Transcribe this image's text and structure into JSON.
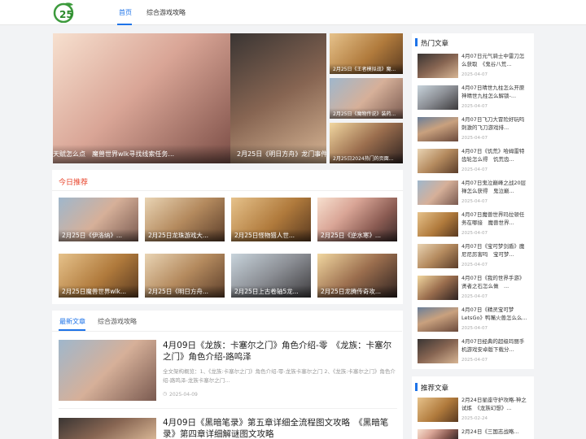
{
  "header": {
    "logo_text": "25",
    "nav": [
      {
        "label": "首页"
      },
      {
        "label": "综合游戏攻略"
      }
    ]
  },
  "carousel": {
    "main_caption_left": "天赋怎么点　魔兽世界wlk寻找线索任务...",
    "main_caption_right": "2月25日《明日方舟》龙门事件...",
    "side": [
      {
        "caption": "2月25日《王者模拟战》魔..."
      },
      {
        "caption": "2月25日《魔物传说》装药..."
      },
      {
        "caption": "2月25日2024热门的页面..."
      }
    ]
  },
  "today": {
    "title": "今日推荐",
    "items": [
      {
        "caption": "2月25日《伊洛纳》..."
      },
      {
        "caption": "2月25日龙珠游戏大..."
      },
      {
        "caption": "2月25日怪物猎人世..."
      },
      {
        "caption": "2月25日《逆水寒》..."
      },
      {
        "caption": "2月25日魔兽世界wlk..."
      },
      {
        "caption": "2月25日《明日方舟..."
      },
      {
        "caption": "2月25日上古卷轴5龙..."
      },
      {
        "caption": "2月25日龙腾传奇攻..."
      }
    ]
  },
  "tabs": {
    "latest": "最新文章",
    "game": "综合游戏攻略"
  },
  "articles": [
    {
      "title": "4月09日《龙族：卡塞尔之门》角色介绍-零　《龙族：卡塞尔之门》角色介绍-路鸣泽",
      "desc": "全文架构概览：1、《龙族:卡塞尔之门》角色介绍-零-龙族卡塞尔之门 2、《龙族:卡塞尔之门》角色介绍-路鸣泽-龙族卡塞尔之门...",
      "date": "2025-04-09"
    },
    {
      "title": "4月09日《黑暗笔录》第五章详细全流程图文攻略　《黑暗笔录》第四章详细解谜图文攻略",
      "desc": "",
      "date": ""
    }
  ],
  "hot": {
    "title": "热门文章",
    "items": [
      {
        "text": "4月07日元气骑士中雷刀怎么获取　《鬼谷八荒...",
        "date": "2025-04-07"
      },
      {
        "text": "4月07日晴世九柱怎么开原神晴世九柱怎么解锁-...",
        "date": "2025-04-07"
      },
      {
        "text": "4月07日飞刀大冒险好玩吗　刺激的飞刀游戏排...",
        "date": "2025-04-07"
      },
      {
        "text": "4月07日《饥荒》哈姆雷特齿轮怎么得　饥荒齿...",
        "date": "2025-04-07"
      },
      {
        "text": "4月07日鬼泣巅峰之战20层禅怎么获得　鬼泣巅...",
        "date": "2025-04-07"
      },
      {
        "text": "4月07日魔兽世界玛拉顿任务在哪接　魔兽世界...",
        "date": "2025-04-07"
      },
      {
        "text": "4月07日《宝可梦剑盾》魔尼尼厉害吗　宝可梦...",
        "date": "2025-04-07"
      },
      {
        "text": "4月07日《我的世界手游》贤者之石怎么做　...",
        "date": "2025-04-07"
      },
      {
        "text": "4月07日《精灵宝可梦LetsGo》鸭嘴火兽怎么么...",
        "date": "2025-04-07"
      },
      {
        "text": "4月07日经典的超级玛丽手机游戏安卓版下载分...",
        "date": "2025-04-07"
      }
    ]
  },
  "recommend": {
    "title": "推荐文章",
    "items": [
      {
        "text": "2月24日星座守护攻略-神之试炼　《龙族幻想》...",
        "date": "2025-02-24"
      },
      {
        "text": "2月24日《三国志战略...",
        "date": ""
      }
    ]
  }
}
